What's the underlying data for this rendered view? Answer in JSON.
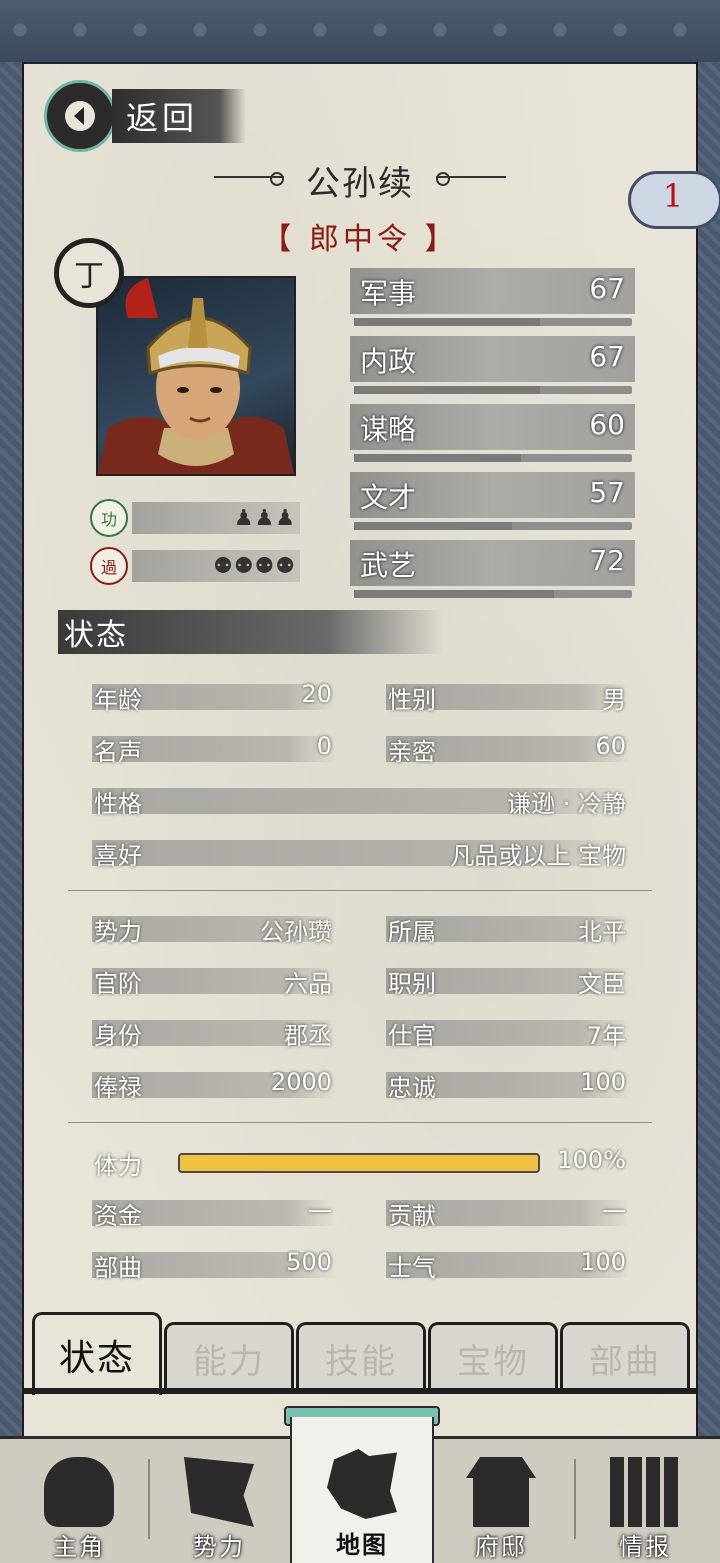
{
  "header": {
    "back_label": "返回",
    "name": "公孙续",
    "title": "【 郎中令 】",
    "badge_count": "1"
  },
  "portrait": {
    "rank": "丁"
  },
  "merits": [
    {
      "icon_label": "功",
      "glyphs": "♟♟♟",
      "name": "merit"
    },
    {
      "icon_label": "過",
      "glyphs": "⚉⚉⚉⚉",
      "name": "demerit"
    }
  ],
  "stats": [
    {
      "label": "军事",
      "value": "67",
      "level": 0.67
    },
    {
      "label": "内政",
      "value": "67",
      "level": 0.67
    },
    {
      "label": "谋略",
      "value": "60",
      "level": 0.6
    },
    {
      "label": "文才",
      "value": "57",
      "level": 0.57
    },
    {
      "label": "武艺",
      "value": "72",
      "level": 0.72
    }
  ],
  "status": {
    "section_title": "状态",
    "age": {
      "k": "年龄",
      "v": "20"
    },
    "gender": {
      "k": "性别",
      "v": "男"
    },
    "fame": {
      "k": "名声",
      "v": "0"
    },
    "intimacy": {
      "k": "亲密",
      "v": "60"
    },
    "personality": {
      "k": "性格",
      "v": "谦逊 · 冷静"
    },
    "hobby": {
      "k": "喜好",
      "v": "凡品或以上 宝物"
    },
    "faction": {
      "k": "势力",
      "v": "公孙瓒"
    },
    "belong": {
      "k": "所属",
      "v": "北平"
    },
    "rank": {
      "k": "官阶",
      "v": "六品"
    },
    "job": {
      "k": "职别",
      "v": "文臣"
    },
    "identity": {
      "k": "身份",
      "v": "郡丞"
    },
    "service": {
      "k": "仕官",
      "v": "7年"
    },
    "salary": {
      "k": "俸禄",
      "v": "2000"
    },
    "loyalty": {
      "k": "忠诚",
      "v": "100"
    },
    "stamina": {
      "k": "体力",
      "v": "100%",
      "level": 1.0
    },
    "funds": {
      "k": "资金",
      "v": "—"
    },
    "contribution": {
      "k": "贡献",
      "v": "—"
    },
    "troops": {
      "k": "部曲",
      "v": "500"
    },
    "morale": {
      "k": "士气",
      "v": "100"
    }
  },
  "tabs": [
    "状态",
    "能力",
    "技能",
    "宝物",
    "部曲"
  ],
  "nav": [
    "主角",
    "势力",
    "地图",
    "府邸",
    "情报"
  ],
  "colors": {
    "title_red": "#8a1c12",
    "stamina": "#f0c040",
    "accent_teal": "#6fb5a4"
  }
}
